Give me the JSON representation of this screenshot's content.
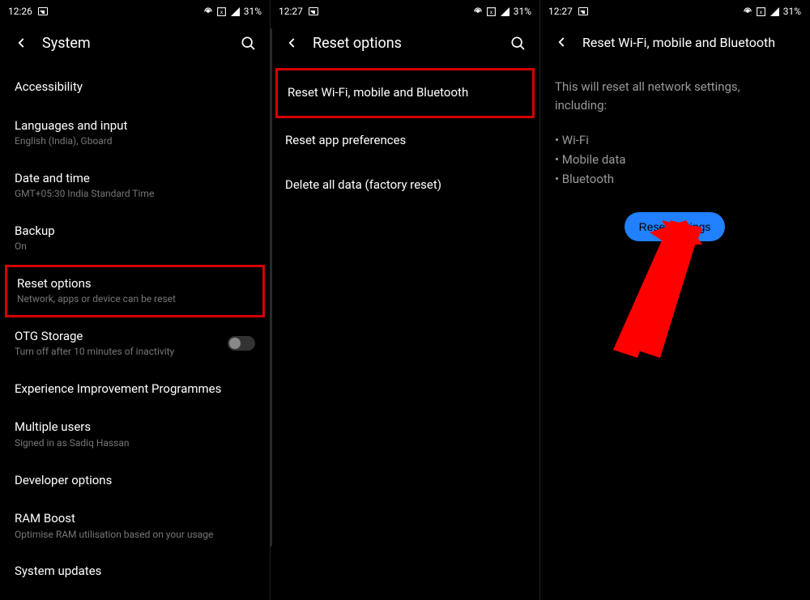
{
  "panel1": {
    "status": {
      "time": "12:26",
      "battery": "31%"
    },
    "title": "System",
    "items": [
      {
        "title": "Accessibility",
        "sub": ""
      },
      {
        "title": "Languages and input",
        "sub": "English (India), Gboard"
      },
      {
        "title": "Date and time",
        "sub": "GMT+05:30 India Standard Time"
      },
      {
        "title": "Backup",
        "sub": "On"
      },
      {
        "title": "Reset options",
        "sub": "Network, apps or device can be reset"
      },
      {
        "title": "OTG Storage",
        "sub": "Turn off after 10 minutes of inactivity"
      },
      {
        "title": "Experience Improvement Programmes",
        "sub": ""
      },
      {
        "title": "Multiple users",
        "sub": "Signed in as Sadiq Hassan"
      },
      {
        "title": "Developer options",
        "sub": ""
      },
      {
        "title": "RAM Boost",
        "sub": "Optimise RAM utilisation based on your usage"
      },
      {
        "title": "System updates",
        "sub": ""
      }
    ]
  },
  "panel2": {
    "status": {
      "time": "12:27",
      "battery": "31%"
    },
    "title": "Reset options",
    "items": [
      {
        "title": "Reset Wi-Fi, mobile and Bluetooth"
      },
      {
        "title": "Reset app preferences"
      },
      {
        "title": "Delete all data (factory reset)"
      }
    ]
  },
  "panel3": {
    "status": {
      "time": "12:27",
      "battery": "31%"
    },
    "title": "Reset Wi-Fi, mobile and Bluetooth",
    "description": "This will reset all network settings, including:",
    "bullets": [
      "Wi-Fi",
      "Mobile data",
      "Bluetooth"
    ],
    "button": "Reset settings"
  }
}
